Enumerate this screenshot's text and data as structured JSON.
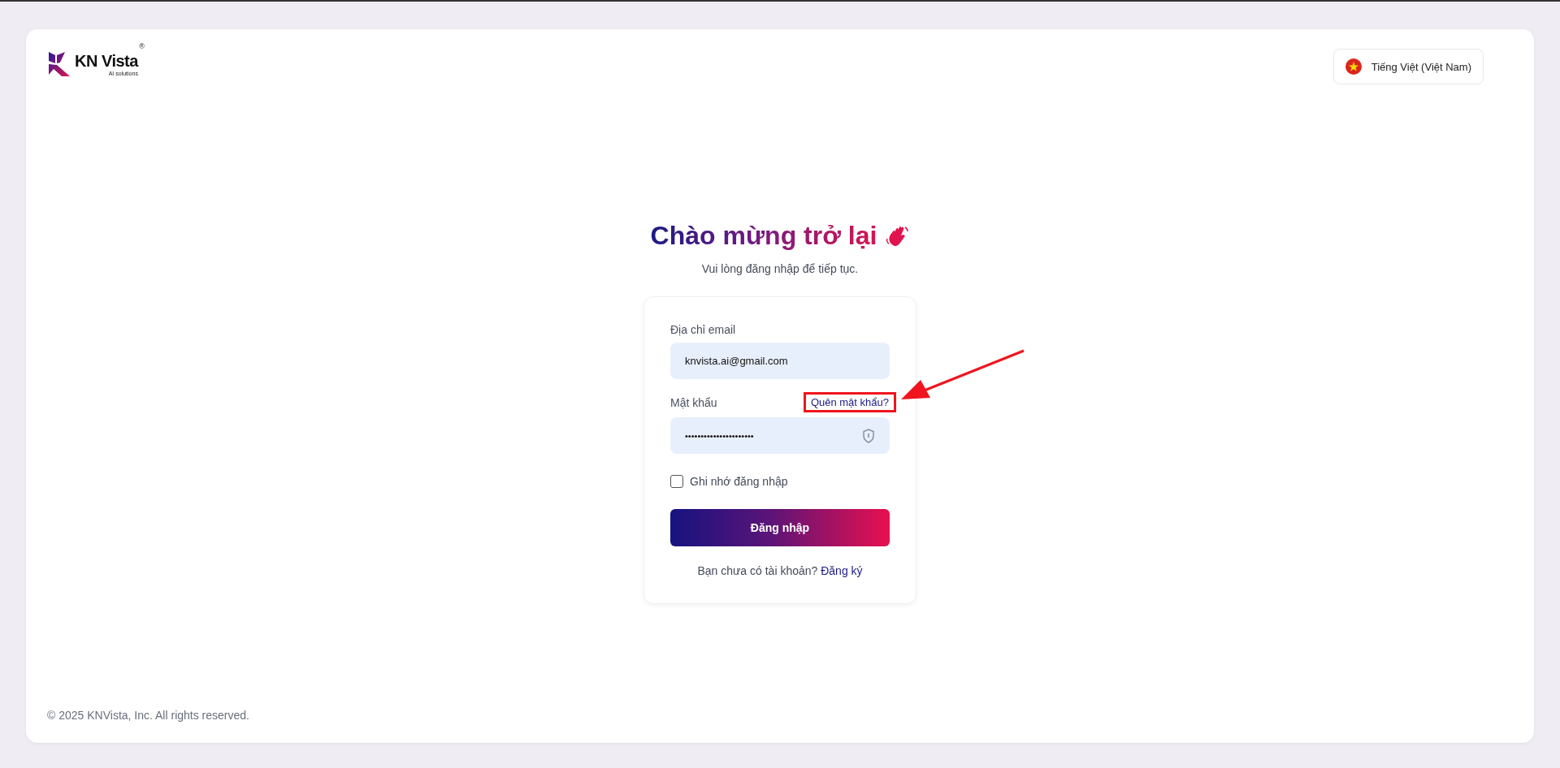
{
  "logo": {
    "name": "KN Vista",
    "registered": "®",
    "tagline": "AI solutions"
  },
  "language": {
    "label": "Tiếng Việt (Việt Nam)"
  },
  "heading": {
    "title": "Chào mừng trở lại",
    "subtitle": "Vui lòng đăng nhập để tiếp tục."
  },
  "form": {
    "email_label": "Địa chỉ email",
    "email_value": "knvista.ai@gmail.com",
    "password_label": "Mật khẩu",
    "forgot_link": "Quên mật khẩu?",
    "password_value": "••••••••••••••••••••••",
    "remember": {
      "label": "Ghi nhớ đăng nhập",
      "checked": false
    },
    "submit": "Đăng nhập",
    "signup_prompt": "Bạn chưa có tài khoản?",
    "signup_link": "Đăng ký"
  },
  "annotation": {
    "highlighted": true
  },
  "footer": "© 2025 KNVista, Inc. All rights reserved."
}
